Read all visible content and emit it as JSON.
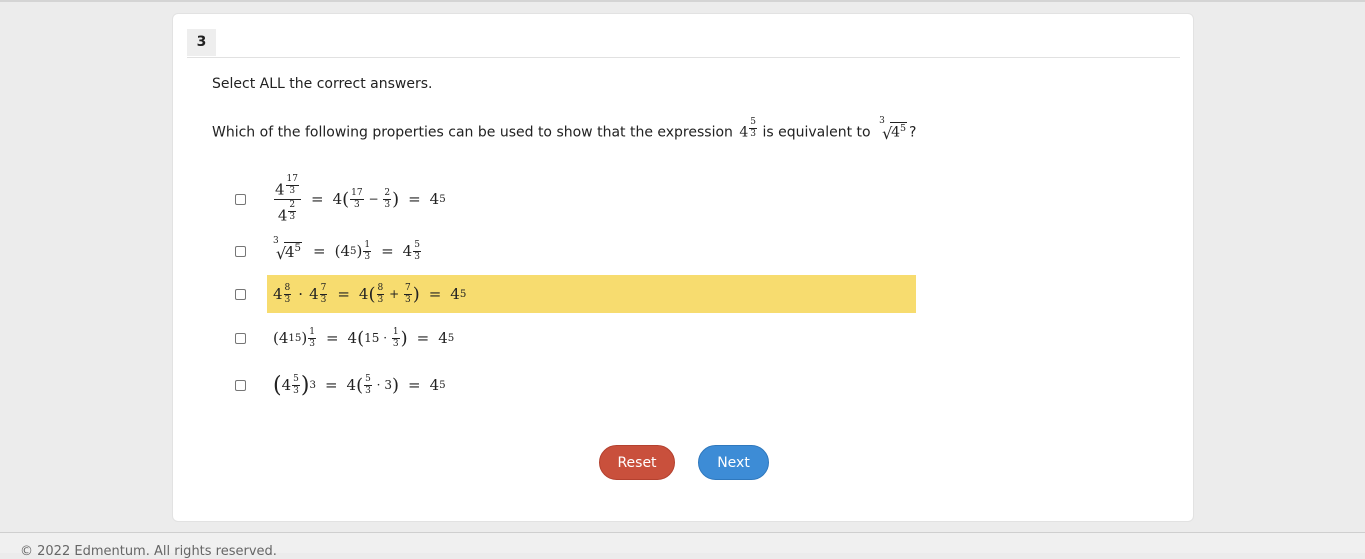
{
  "question": {
    "number": "3",
    "instruction": "Select ALL the correct answers.",
    "text_before": "Which of the following properties can be used to show that the expression",
    "text_middle": "is equivalent to",
    "text_end": "?",
    "expr_base": "4",
    "expr_exp_num": "5",
    "expr_exp_den": "3",
    "root_index": "3",
    "root_base": "4",
    "root_exp": "5"
  },
  "options": [
    {
      "id": "a",
      "checked": false,
      "highlighted": false
    },
    {
      "id": "b",
      "checked": false,
      "highlighted": false
    },
    {
      "id": "c",
      "checked": false,
      "highlighted": true
    },
    {
      "id": "d",
      "checked": false,
      "highlighted": false
    },
    {
      "id": "e",
      "checked": false,
      "highlighted": false
    }
  ],
  "math": {
    "four": "4",
    "equals": "=",
    "minus": "−",
    "plus": "+",
    "dot": "·",
    "lparen": "(",
    "rparen": ")",
    "n17": "17",
    "n3": "3",
    "n2": "2",
    "n5": "5",
    "n1": "1",
    "n8": "8",
    "n7": "7",
    "n15": "15"
  },
  "buttons": {
    "reset": "Reset",
    "next": "Next"
  },
  "footer": {
    "copyright": "© 2022 Edmentum. All rights reserved."
  },
  "colors": {
    "reset": "#c9503c",
    "next": "#3d8cd6",
    "highlight": "#f7dc6f"
  }
}
